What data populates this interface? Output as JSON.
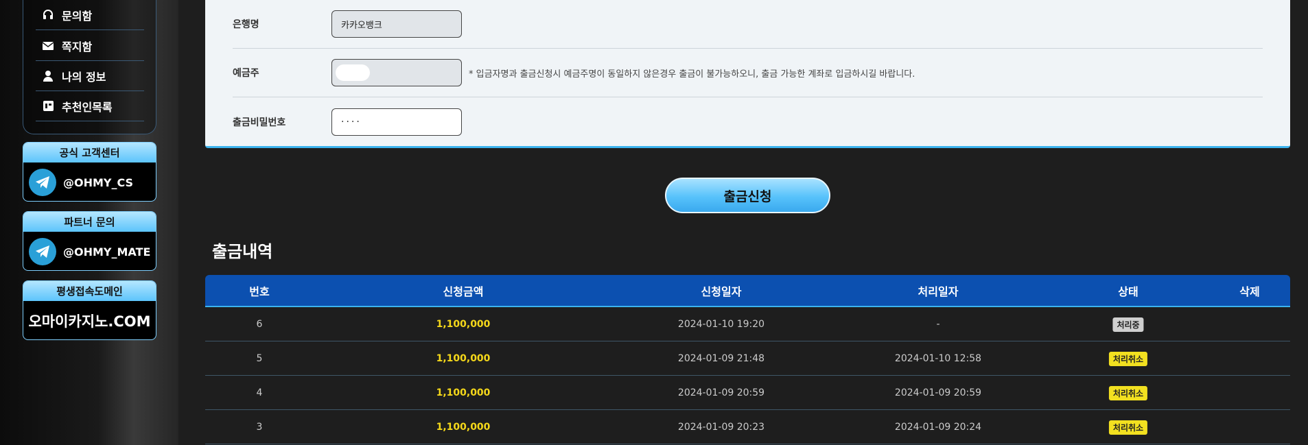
{
  "sidebar": {
    "menu": [
      {
        "label": "문의함",
        "icon": "headset-icon"
      },
      {
        "label": "쪽지함",
        "icon": "envelope-icon"
      },
      {
        "label": "나의 정보",
        "icon": "user-icon"
      },
      {
        "label": "추천인목록",
        "icon": "list-icon"
      }
    ],
    "cs_center": {
      "title": "공식 고객센터",
      "handle": "@OHMY_CS"
    },
    "partner": {
      "title": "파트너 문의",
      "handle": "@OHMY_MATE"
    },
    "domain": {
      "title": "평생접속도메인",
      "value": "오마이카지노.COM"
    }
  },
  "form": {
    "bank": {
      "label": "은행명",
      "value": "카카오뱅크"
    },
    "holder": {
      "label": "예금주",
      "notice": "* 입금자명과 출금신청시 예금주명이 동일하지 않은경우 출금이 불가능하오니, 출금 가능한 계좌로 입금하시길 바랍니다."
    },
    "password": {
      "label": "출금비밀번호",
      "value": "····"
    }
  },
  "submit_label": "출금신청",
  "history": {
    "title": "출금내역",
    "columns": [
      "번호",
      "신청금액",
      "신청일자",
      "처리일자",
      "상태",
      "삭제"
    ],
    "rows": [
      {
        "no": "6",
        "amount": "1,100,000",
        "requested": "2024-01-10 19:20",
        "processed": "-",
        "status": "처리중",
        "status_type": "pending"
      },
      {
        "no": "5",
        "amount": "1,100,000",
        "requested": "2024-01-09 21:48",
        "processed": "2024-01-10 12:58",
        "status": "처리취소",
        "status_type": "cancel"
      },
      {
        "no": "4",
        "amount": "1,100,000",
        "requested": "2024-01-09 20:59",
        "processed": "2024-01-09 20:59",
        "status": "처리취소",
        "status_type": "cancel"
      },
      {
        "no": "3",
        "amount": "1,100,000",
        "requested": "2024-01-09 20:23",
        "processed": "2024-01-09 20:24",
        "status": "처리취소",
        "status_type": "cancel"
      }
    ]
  },
  "colors": {
    "accent": "#3cb3ee",
    "header": "#0c50b0",
    "amount": "#f5d81a",
    "badge_cancel": "#f2e020"
  }
}
